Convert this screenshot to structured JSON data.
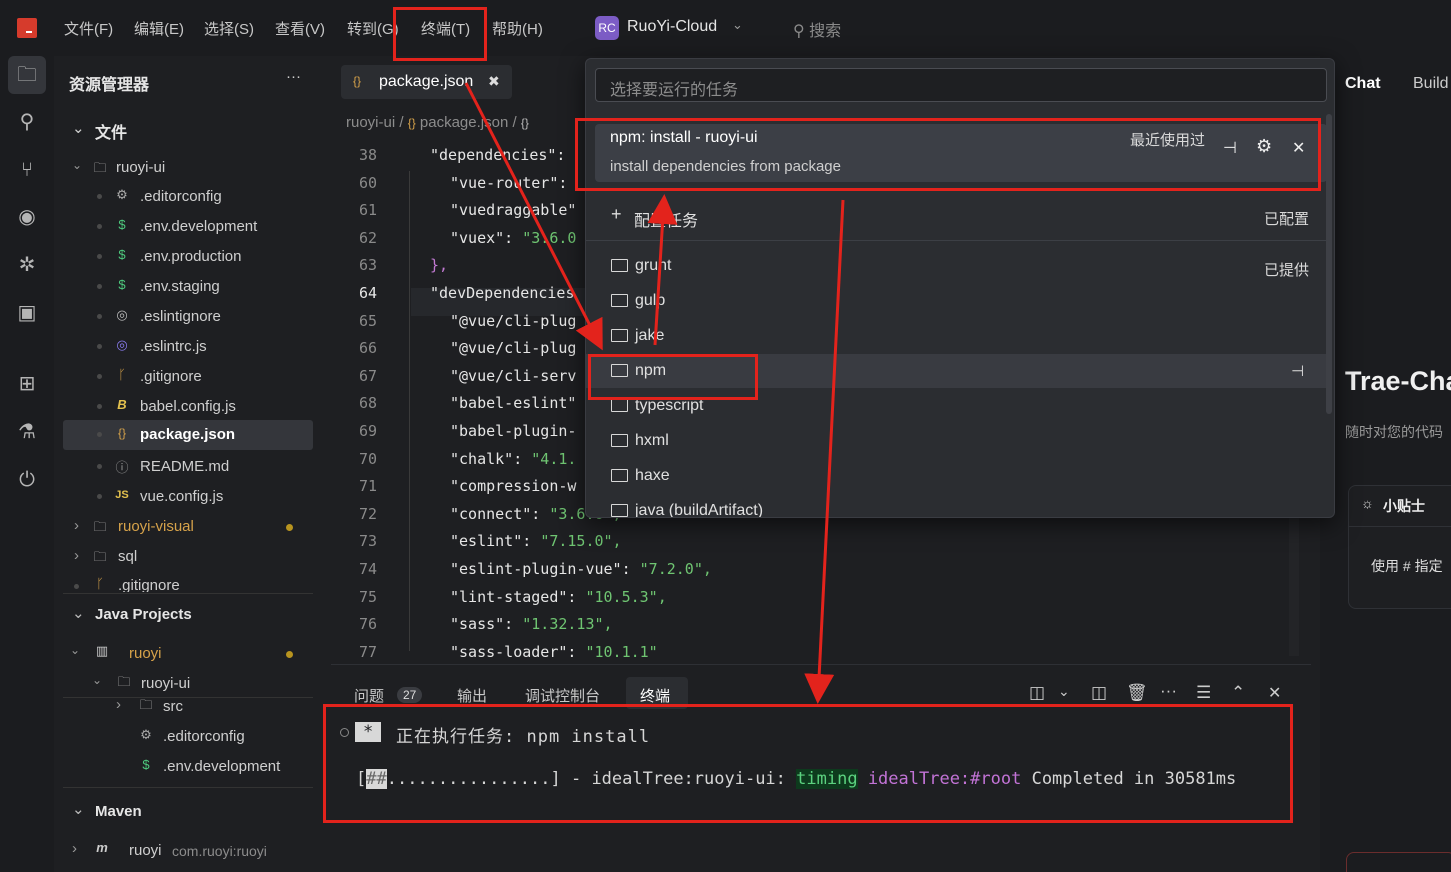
{
  "menubar": {
    "items": [
      "文件(F)",
      "编辑(E)",
      "选择(S)",
      "查看(V)",
      "转到(G)",
      "终端(T)",
      "帮助(H)"
    ],
    "project_badge": "RC",
    "project_name": "RuoYi-Cloud",
    "search": "搜索"
  },
  "sidebar": {
    "title": "资源管理器",
    "more": "···",
    "files_section": "文件",
    "tree": [
      {
        "label": "ruoyi-ui"
      },
      {
        "label": ".editorconfig"
      },
      {
        "label": ".env.development"
      },
      {
        "label": ".env.production"
      },
      {
        "label": ".env.staging"
      },
      {
        "label": ".eslintignore"
      },
      {
        "label": ".eslintrc.js"
      },
      {
        "label": ".gitignore"
      },
      {
        "label": "babel.config.js"
      },
      {
        "label": "package.json"
      },
      {
        "label": "README.md"
      },
      {
        "label": "vue.config.js"
      },
      {
        "label": "ruoyi-visual"
      },
      {
        "label": "sql"
      },
      {
        "label": ".gitignore"
      }
    ],
    "java_section": "Java Projects",
    "java_tree": [
      {
        "label": "ruoyi"
      },
      {
        "label": "ruoyi-ui"
      },
      {
        "label": "src"
      },
      {
        "label": ".editorconfig"
      },
      {
        "label": ".env.development"
      }
    ],
    "maven_section": "Maven",
    "maven_project": "ruoyi",
    "maven_coord": "com.ruoyi:ruoyi"
  },
  "editor": {
    "tab_label": "package.json",
    "tab_close": "✖",
    "breadcrumb": [
      "ruoyi-ui",
      "package.json"
    ],
    "lines": [
      {
        "n": "38",
        "key": "\"dependencies\":",
        "val": ""
      },
      {
        "n": "60",
        "key": "\"vue-router\":",
        "val": ""
      },
      {
        "n": "61",
        "key": "\"vuedraggable\"",
        "val": ""
      },
      {
        "n": "62",
        "key": "\"vuex\": ",
        "val": "\"3.6.0"
      },
      {
        "n": "63",
        "key": "},",
        "val": ""
      },
      {
        "n": "64",
        "key": "\"devDependencies",
        "val": ""
      },
      {
        "n": "65",
        "key": "\"@vue/cli-plug",
        "val": ""
      },
      {
        "n": "66",
        "key": "\"@vue/cli-plug",
        "val": ""
      },
      {
        "n": "67",
        "key": "\"@vue/cli-serv",
        "val": ""
      },
      {
        "n": "68",
        "key": "\"babel-eslint\"",
        "val": ""
      },
      {
        "n": "69",
        "key": "\"babel-plugin-",
        "val": ""
      },
      {
        "n": "70",
        "key": "\"chalk\": ",
        "val": "\"4.1."
      },
      {
        "n": "71",
        "key": "\"compression-w",
        "val": ""
      },
      {
        "n": "72",
        "key": "\"connect\": ",
        "val": "\"3.6.6\","
      },
      {
        "n": "73",
        "key": "\"eslint\": ",
        "val": "\"7.15.0\","
      },
      {
        "n": "74",
        "key": "\"eslint-plugin-vue\": ",
        "val": "\"7.2.0\","
      },
      {
        "n": "75",
        "key": "\"lint-staged\": ",
        "val": "\"10.5.3\","
      },
      {
        "n": "76",
        "key": "\"sass\": ",
        "val": "\"1.32.13\","
      },
      {
        "n": "77",
        "key": "\"sass-loader\": ",
        "val": "\"10.1.1\""
      }
    ]
  },
  "palette": {
    "placeholder": "选择要运行的任务",
    "recent_task": "npm: install - ruoyi-ui",
    "recent_desc": "install dependencies from package",
    "recent_tag": "最近使用过",
    "configure": "配置任务",
    "configured": "已配置",
    "provided": "已提供",
    "items": [
      "grunt",
      "gulp",
      "jake",
      "npm",
      "typescript",
      "hxml",
      "haxe",
      "java (buildArtifact)"
    ]
  },
  "right_panel": {
    "tabs": [
      "Chat",
      "Build"
    ],
    "title": "Trae-Cha",
    "subtitle": "随时对您的代码",
    "tip_title": "小贴士",
    "tip_body": "使用 # 指定"
  },
  "bottom_panel": {
    "tabs": [
      "问题",
      "输出",
      "调试控制台",
      "终端"
    ],
    "problem_count": "27",
    "task_star": "*",
    "task_line": "正在执行任务: npm install",
    "progress_open": "[",
    "progress_done": "##",
    "progress_rest": "................",
    "progress_close": "] - idealTree:ruoyi-ui: ",
    "timing": "timing",
    "idealtree": "idealTree:#root",
    "completed": " Completed in 30581ms"
  }
}
